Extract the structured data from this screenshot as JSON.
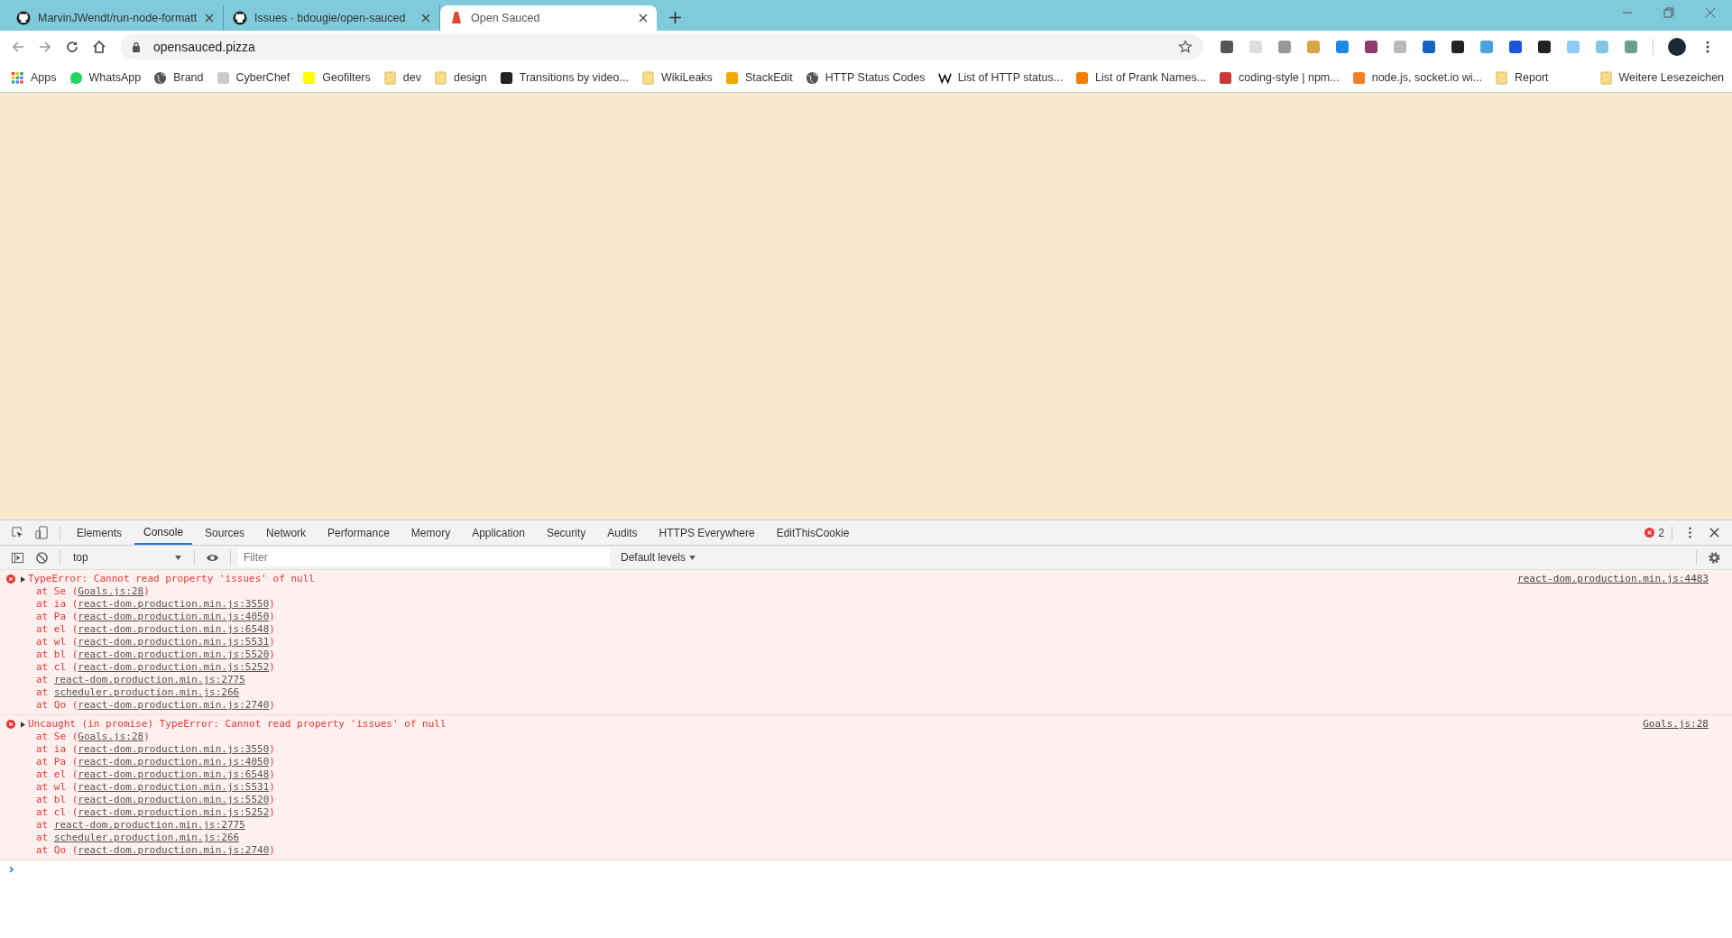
{
  "tabs": [
    {
      "title": "MarvinJWendt/run-node-formatt",
      "kind": "github",
      "selected": false
    },
    {
      "title": "Issues · bdougie/open-sauced",
      "kind": "github",
      "selected": false
    },
    {
      "title": "Open Sauced",
      "kind": "sauce",
      "selected": true
    }
  ],
  "address": {
    "url": "opensauced.pizza"
  },
  "bookmarks": [
    {
      "label": "Apps",
      "kind": "apps"
    },
    {
      "label": "WhatsApp",
      "kind": "whatsapp"
    },
    {
      "label": "Brand",
      "kind": "globe"
    },
    {
      "label": "CyberChef",
      "kind": "chef"
    },
    {
      "label": "Geofilters",
      "kind": "snap"
    },
    {
      "label": "dev",
      "kind": "folder"
    },
    {
      "label": "design",
      "kind": "folder"
    },
    {
      "label": "Transitions by video...",
      "kind": "dark"
    },
    {
      "label": "WikiLeaks",
      "kind": "folder"
    },
    {
      "label": "StackEdit",
      "kind": "stackedit"
    },
    {
      "label": "HTTP Status Codes",
      "kind": "globe"
    },
    {
      "label": "List of HTTP status...",
      "kind": "wiki"
    },
    {
      "label": "List of Prank Names...",
      "kind": "blogger"
    },
    {
      "label": "coding-style | npm...",
      "kind": "npm"
    },
    {
      "label": "node.js, socket.io wi...",
      "kind": "so"
    },
    {
      "label": "Report",
      "kind": "folder"
    }
  ],
  "other_bookmarks": {
    "label": "Weitere Lesezeichen"
  },
  "devtools": {
    "tabs": [
      {
        "label": "Elements",
        "selected": false
      },
      {
        "label": "Console",
        "selected": true
      },
      {
        "label": "Sources",
        "selected": false
      },
      {
        "label": "Network",
        "selected": false
      },
      {
        "label": "Performance",
        "selected": false
      },
      {
        "label": "Memory",
        "selected": false
      },
      {
        "label": "Application",
        "selected": false
      },
      {
        "label": "Security",
        "selected": false
      },
      {
        "label": "Audits",
        "selected": false
      },
      {
        "label": "HTTPS Everywhere",
        "selected": false
      },
      {
        "label": "EditThisCookie",
        "selected": false
      }
    ],
    "error_count": "2",
    "context": "top",
    "filter": {
      "placeholder": "Filter"
    },
    "levels": "Default levels",
    "messages": [
      {
        "text": "TypeError: Cannot read property 'issues' of null",
        "source": "react-dom.production.min.js:4483",
        "expanded": false,
        "frames": [
          {
            "before": "at Se (",
            "link": "Goals.js:28",
            "after": ")"
          },
          {
            "before": "at ia (",
            "link": "react-dom.production.min.js:3550",
            "after": ")"
          },
          {
            "before": "at Pa (",
            "link": "react-dom.production.min.js:4050",
            "after": ")"
          },
          {
            "before": "at el (",
            "link": "react-dom.production.min.js:6548",
            "after": ")"
          },
          {
            "before": "at wl (",
            "link": "react-dom.production.min.js:5531",
            "after": ")"
          },
          {
            "before": "at bl (",
            "link": "react-dom.production.min.js:5520",
            "after": ")"
          },
          {
            "before": "at cl (",
            "link": "react-dom.production.min.js:5252",
            "after": ")"
          },
          {
            "before": "at ",
            "link": "react-dom.production.min.js:2775"
          },
          {
            "before": "at ",
            "link": "scheduler.production.min.js:266"
          },
          {
            "before": "at Qo (",
            "link": "react-dom.production.min.js:2740",
            "after": ")"
          }
        ]
      },
      {
        "text": "Uncaught (in promise) TypeError: Cannot read property 'issues' of null",
        "source": "Goals.js:28",
        "expanded": false,
        "frames": [
          {
            "before": "at Se (",
            "link": "Goals.js:28",
            "after": ")"
          },
          {
            "before": "at ia (",
            "link": "react-dom.production.min.js:3550",
            "after": ")"
          },
          {
            "before": "at Pa (",
            "link": "react-dom.production.min.js:4050",
            "after": ")"
          },
          {
            "before": "at el (",
            "link": "react-dom.production.min.js:6548",
            "after": ")"
          },
          {
            "before": "at wl (",
            "link": "react-dom.production.min.js:5531",
            "after": ")"
          },
          {
            "before": "at bl (",
            "link": "react-dom.production.min.js:5520",
            "after": ")"
          },
          {
            "before": "at cl (",
            "link": "react-dom.production.min.js:5252",
            "after": ")"
          },
          {
            "before": "at ",
            "link": "react-dom.production.min.js:2775"
          },
          {
            "before": "at ",
            "link": "scheduler.production.min.js:266"
          },
          {
            "before": "at Qo (",
            "link": "react-dom.production.min.js:2740",
            "after": ")"
          }
        ]
      }
    ]
  }
}
